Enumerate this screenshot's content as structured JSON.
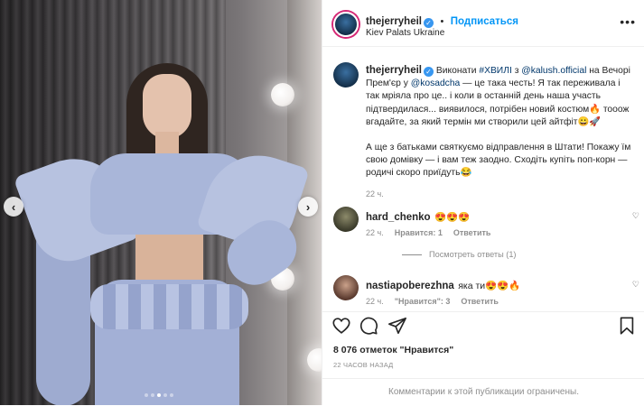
{
  "post": {
    "username": "thejerryheil",
    "follow_label": "Подписаться",
    "separator": "•",
    "location": "Kiev Palats Ukraine",
    "more_label": "•••",
    "verified_glyph": "✓"
  },
  "photo": {
    "prev_label": "‹",
    "next_label": "›",
    "dots_count": 5,
    "active_dot": 2
  },
  "caption": {
    "username": "thejerryheil",
    "part1": " Виконати ",
    "tag": "#ХВИЛІ",
    "part2": " з ",
    "mention1": "@kalush.official",
    "part3": " на Вечорі Прем'єр у ",
    "mention2": "@kosadcha",
    "part4": " — це така честь! Я так переживала і так мріяла про це.. і коли в останній день наша участь підтвердилася... виявилося, потрібен новий костюм🔥 тооож вгадайте, за який термін ми створили цей айтфіт😀🚀",
    "part5": "А ще з батьками святкуємо відправлення в Штати! Покажу їм свою домівку — і вам теж заодно. Сходіть купіть поп-корн — родичі скоро приїдуть😂",
    "time": "22 ч."
  },
  "comments": [
    {
      "username": "hard_chenko",
      "text": "😍😍😍",
      "time": "22 ч.",
      "likes": "Нравится: 1",
      "reply": "Ответить"
    },
    {
      "username": "nastiapoberezhna",
      "text": " яка ти😍😍🔥",
      "time": "22 ч.",
      "likes": "\"Нравится\": 3",
      "reply": "Ответить"
    }
  ],
  "view_replies": "Посмотреть ответы (1)",
  "likes_label": "8 076 отметок \"Нравится\"",
  "posted_time": "22 ЧАСОВ НАЗАД",
  "comments_disabled": "Комментарии к этой публикации ограничены.",
  "icons": [
    "heart-icon",
    "comment-icon",
    "share-icon",
    "bookmark-icon"
  ],
  "colors": {
    "link": "#00376b",
    "follow": "#0095f6",
    "muted": "#8e8e8e",
    "verified": "#3897f0"
  }
}
